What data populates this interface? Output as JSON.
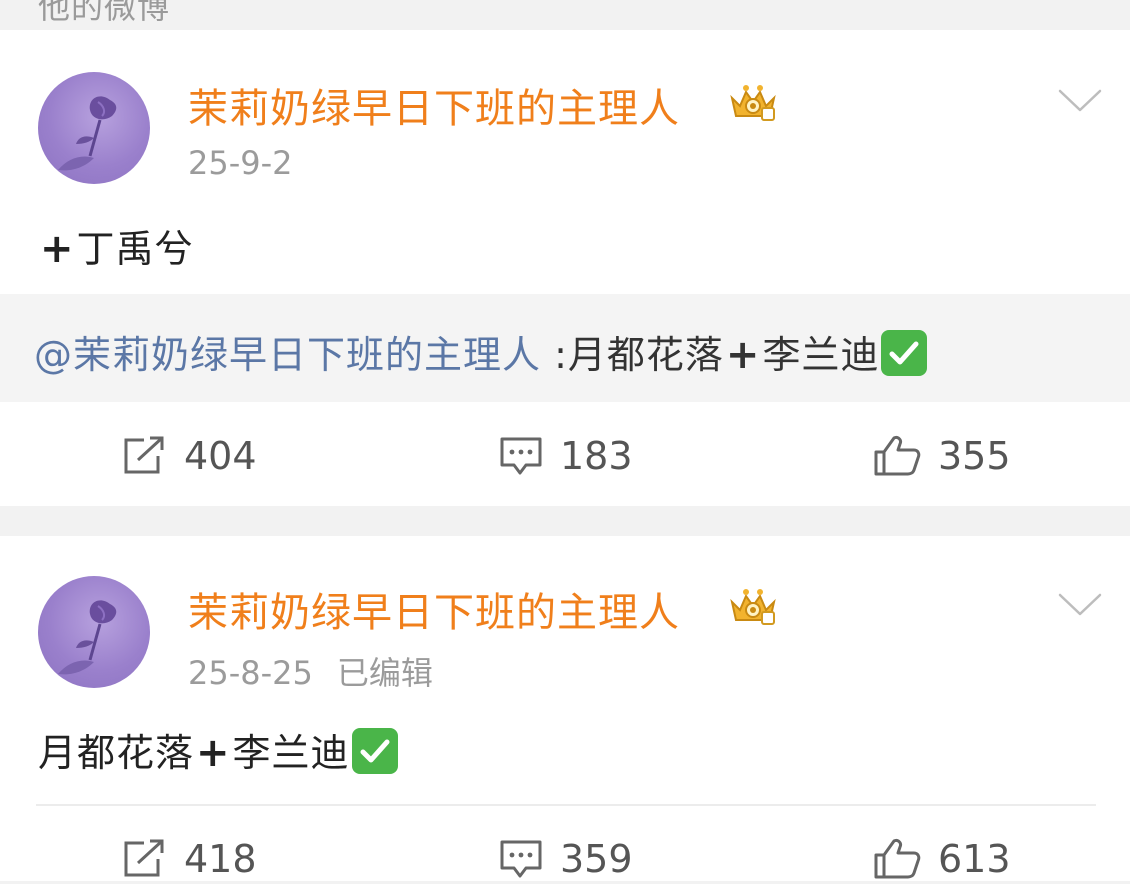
{
  "section_header": "他的微博",
  "posts": [
    {
      "user": {
        "name": "茉莉奶绿早日下班的主理人",
        "badge": "vip-crown-badge"
      },
      "date": "25-9-2",
      "edited": "",
      "text": "丁禹兮",
      "text_prefix": "+",
      "repost": {
        "mention": "@茉莉奶绿早日下班的主理人",
        "separator": " :",
        "text_before": "月都花落",
        "plus": "+",
        "text_after": "李兰迪"
      },
      "stats": {
        "reposts": "404",
        "comments": "183",
        "likes": "355"
      }
    },
    {
      "user": {
        "name": "茉莉奶绿早日下班的主理人",
        "badge": "vip-crown-badge"
      },
      "date": "25-8-25",
      "edited": "已编辑",
      "text_before": "月都花落",
      "plus": "+",
      "text_after": "李兰迪",
      "stats": {
        "reposts": "418",
        "comments": "359",
        "likes": "613"
      }
    }
  ],
  "colors": {
    "username": "#f07f1b",
    "mention": "#5b77a6",
    "check": "#4ab549",
    "meta": "#9b9b9b"
  },
  "icons": [
    "rose-avatar",
    "vip-crown-badge",
    "chevron-down-icon",
    "repost-icon",
    "comment-icon",
    "like-icon",
    "check-mark-emoji"
  ]
}
